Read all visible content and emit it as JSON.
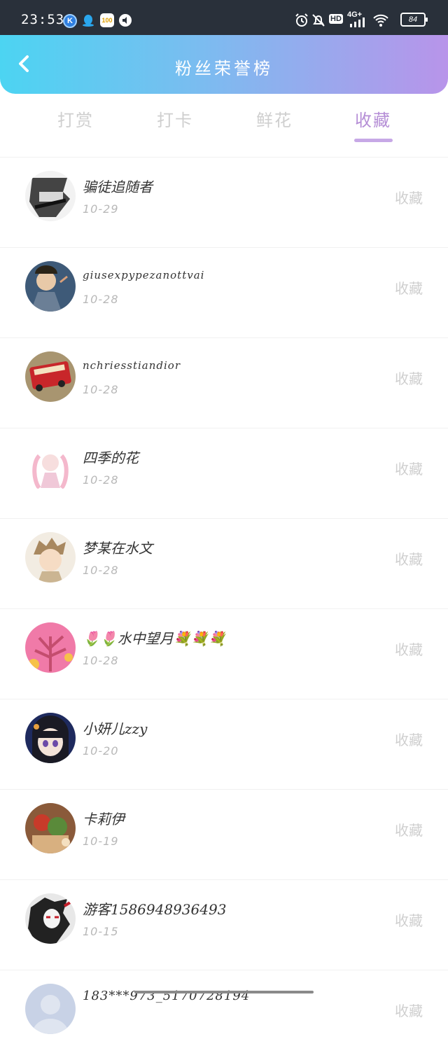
{
  "status_bar": {
    "time": "23:53",
    "network": "4G+",
    "hd": "HD",
    "battery": "84",
    "apps": [
      {
        "icon": "k-app-icon",
        "glyph": "K",
        "color": "#2f7fe0"
      },
      {
        "icon": "qq-icon",
        "glyph": "",
        "color": "#2aa7ee"
      },
      {
        "icon": "app-100-icon",
        "glyph": "100",
        "color": "#f5c518"
      },
      {
        "icon": "mute-app-icon",
        "glyph": "",
        "color": "#ffffff"
      }
    ]
  },
  "header": {
    "title": "粉丝荣誉榜",
    "back_icon": "chevron-left-icon"
  },
  "tabs": [
    {
      "label": "打赏",
      "active": false
    },
    {
      "label": "打卡",
      "active": false
    },
    {
      "label": "鲜花",
      "active": false
    },
    {
      "label": "收藏",
      "active": true
    }
  ],
  "fans": [
    {
      "name": "骗徒追随者",
      "date": "10-29",
      "action": "收藏",
      "avatar_colors": [
        "#f2f2f2",
        "#333333"
      ]
    },
    {
      "name": "giusexpypezanottvai",
      "date": "10-28",
      "action": "收藏",
      "avatar_colors": [
        "#3e5a78",
        "#e8c9a8"
      ]
    },
    {
      "name": "nchriesstiandior",
      "date": "10-28",
      "action": "收藏",
      "avatar_colors": [
        "#a89570",
        "#c8262a"
      ]
    },
    {
      "name": "四季的花",
      "date": "10-28",
      "action": "收藏",
      "avatar_colors": [
        "#ffffff",
        "#f4b8cc"
      ]
    },
    {
      "name": "梦某在水文",
      "date": "10-28",
      "action": "收藏",
      "avatar_colors": [
        "#f2ece2",
        "#a88860"
      ]
    },
    {
      "name": "🌷🌷水中望月💐💐💐",
      "date": "10-28",
      "action": "收藏",
      "avatar_colors": [
        "#f07aa8",
        "#c44d6e"
      ]
    },
    {
      "name": "小妍儿zzy",
      "date": "10-20",
      "action": "收藏",
      "avatar_colors": [
        "#1e2a5e",
        "#f3e3d8"
      ]
    },
    {
      "name": "卡莉伊",
      "date": "10-19",
      "action": "收藏",
      "avatar_colors": [
        "#8a5a3a",
        "#c83a2a"
      ]
    },
    {
      "name": "游客1586948936493",
      "date": "10-15",
      "action": "收藏",
      "avatar_colors": [
        "#e8e8e8",
        "#222222"
      ]
    },
    {
      "name": "183***973_5170728194",
      "date": "",
      "action": "收藏",
      "avatar_colors": [
        "#c8d2e6",
        "#dfe5f0"
      ]
    }
  ]
}
